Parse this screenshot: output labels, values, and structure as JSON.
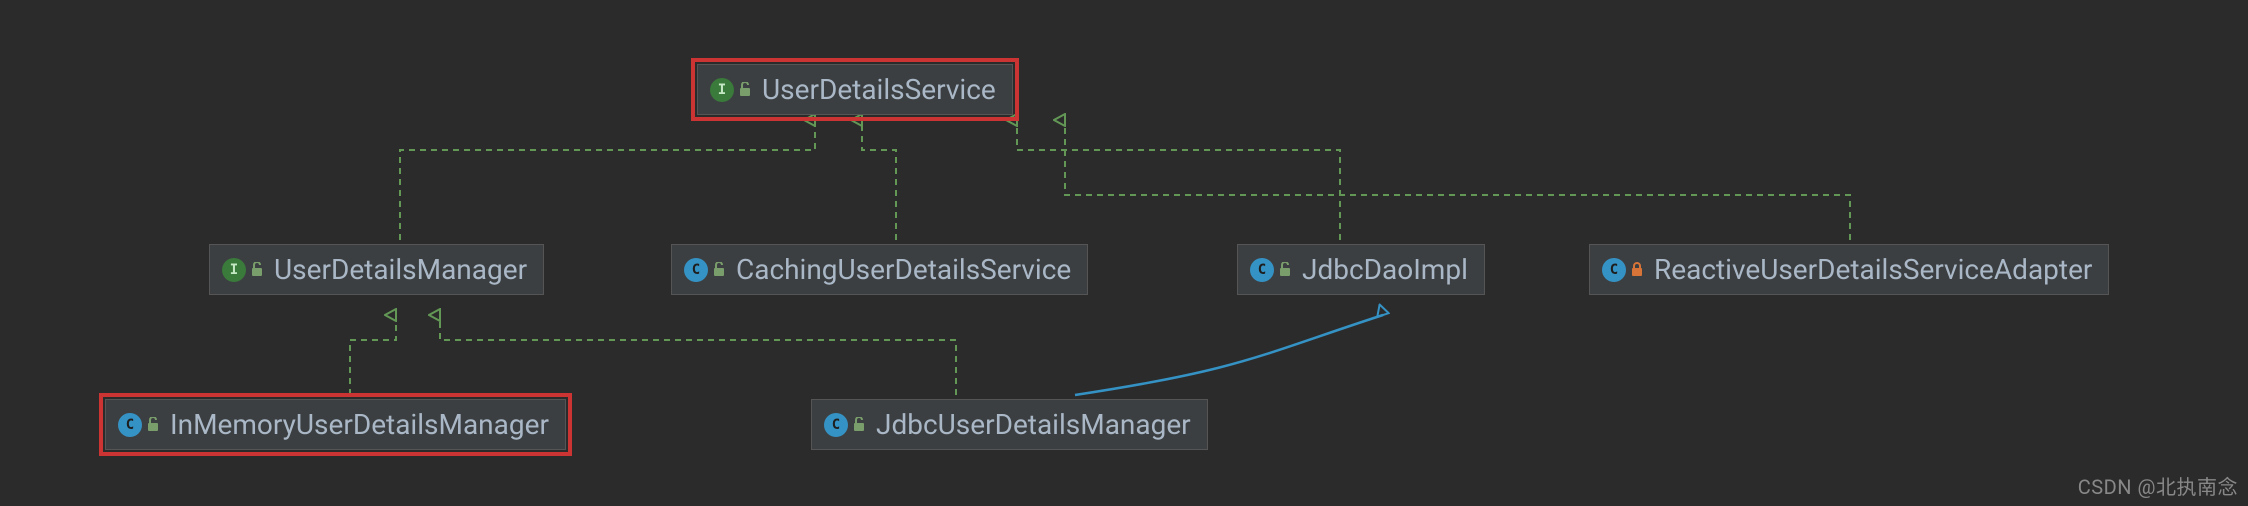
{
  "chart_data": {
    "type": "diagram",
    "title": "",
    "nodes": [
      {
        "id": "uds",
        "kind": "interface",
        "access": "open",
        "label": "UserDetailsService",
        "highlight": true
      },
      {
        "id": "udm",
        "kind": "interface",
        "access": "open",
        "label": "UserDetailsManager",
        "highlight": false
      },
      {
        "id": "cuds",
        "kind": "class",
        "access": "open",
        "label": "CachingUserDetailsService",
        "highlight": false
      },
      {
        "id": "jdi",
        "kind": "class",
        "access": "open",
        "label": "JdbcDaoImpl",
        "highlight": false
      },
      {
        "id": "rudsa",
        "kind": "class",
        "access": "closed",
        "label": "ReactiveUserDetailsServiceAdapter",
        "highlight": false
      },
      {
        "id": "imudm",
        "kind": "class",
        "access": "open",
        "label": "InMemoryUserDetailsManager",
        "highlight": true
      },
      {
        "id": "judm",
        "kind": "class",
        "access": "open",
        "label": "JdbcUserDetailsManager",
        "highlight": false
      }
    ],
    "edges": [
      {
        "from": "udm",
        "to": "uds",
        "style": "realize"
      },
      {
        "from": "cuds",
        "to": "uds",
        "style": "realize"
      },
      {
        "from": "jdi",
        "to": "uds",
        "style": "realize"
      },
      {
        "from": "rudsa",
        "to": "uds",
        "style": "realize"
      },
      {
        "from": "imudm",
        "to": "udm",
        "style": "realize"
      },
      {
        "from": "judm",
        "to": "udm",
        "style": "realize"
      },
      {
        "from": "judm",
        "to": "jdi",
        "style": "extend"
      }
    ],
    "legend": {
      "realize": "implements (green dashed, open triangle)",
      "extend": "extends (blue solid, open triangle)"
    }
  },
  "colors": {
    "bg": "#2b2b2b",
    "node_bg": "#3c3f41",
    "node_border": "#555555",
    "highlight": "#cc3333",
    "implements": "#629755",
    "extends": "#3592c4",
    "text": "#a9b7c6"
  },
  "watermark": "CSDN @北执南念"
}
